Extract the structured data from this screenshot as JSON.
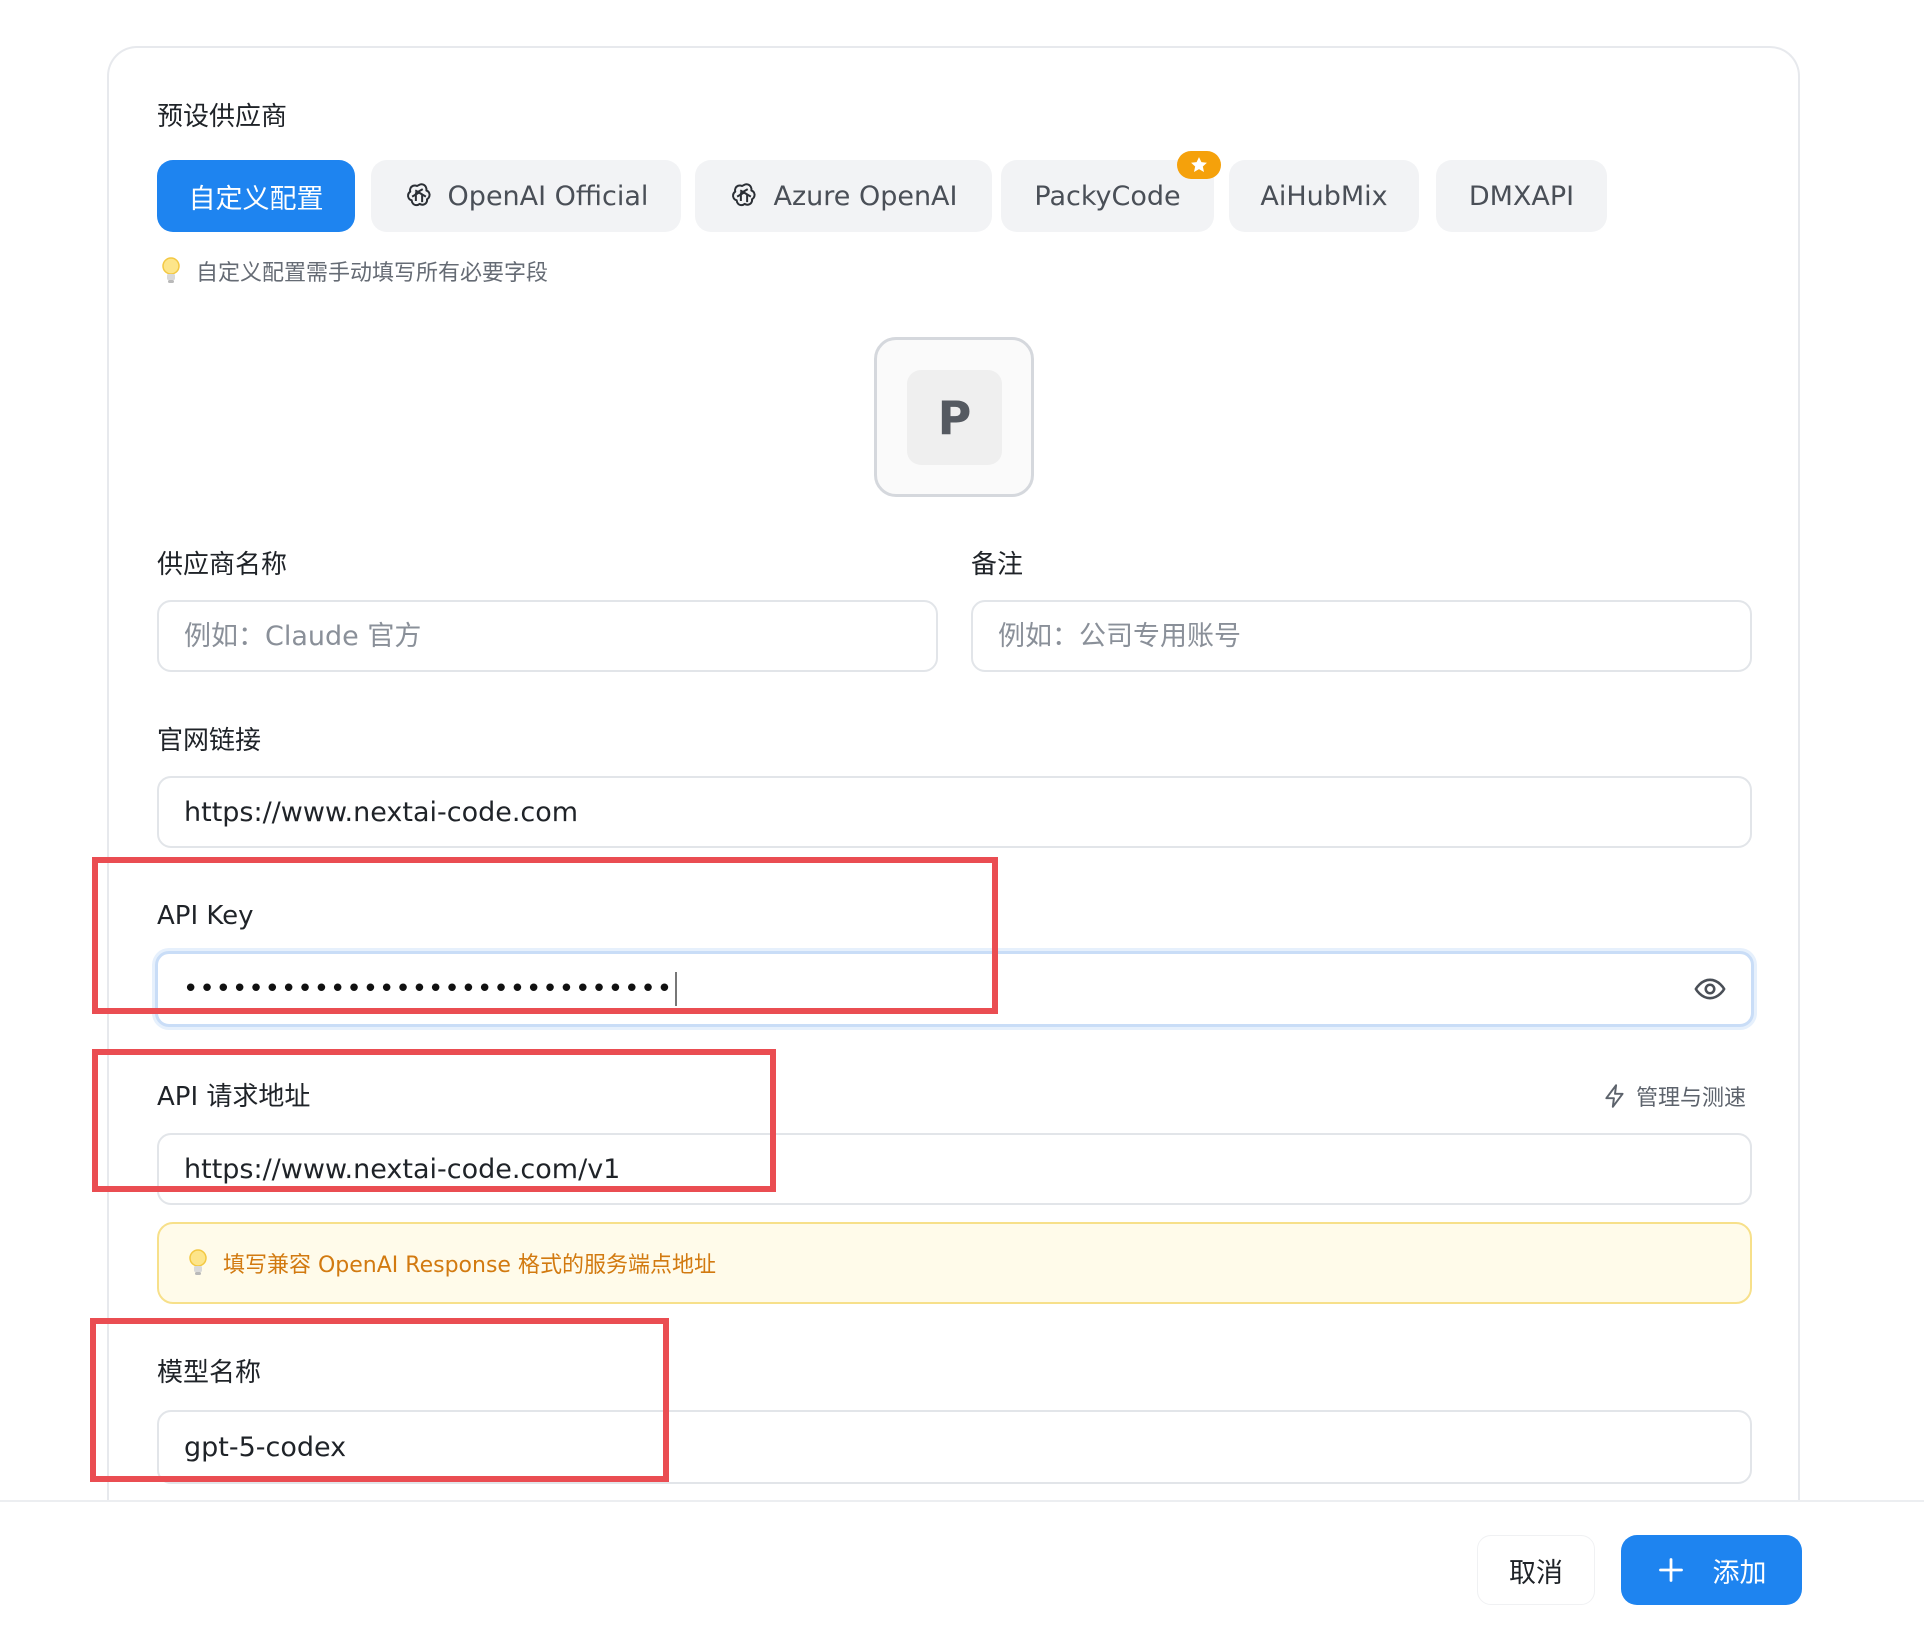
{
  "presets": {
    "heading": "预设供应商",
    "items": [
      {
        "label": "自定义配置",
        "active": true,
        "icon": ""
      },
      {
        "label": "OpenAI Official",
        "active": false,
        "icon": "openai-icon"
      },
      {
        "label": "Azure OpenAI",
        "active": false,
        "icon": "openai-icon"
      },
      {
        "label": "PackyCode",
        "active": false,
        "icon": "",
        "badge": "star-icon"
      },
      {
        "label": "AiHubMix",
        "active": false,
        "icon": ""
      },
      {
        "label": "DMXAPI",
        "active": false,
        "icon": ""
      }
    ],
    "hint": "自定义配置需手动填写所有必要字段"
  },
  "logo": {
    "letter": "P"
  },
  "form": {
    "provider_name": {
      "label": "供应商名称",
      "placeholder": "例如：Claude 官方",
      "value": ""
    },
    "note": {
      "label": "备注",
      "placeholder": "例如：公司专用账号",
      "value": ""
    },
    "website": {
      "label": "官网链接",
      "value": "https://www.nextai-code.com"
    },
    "api_key": {
      "label": "API Key",
      "masked_value": "••••••••••••••••••••••••••••••"
    },
    "api_endpoint": {
      "label": "API 请求地址",
      "value": "https://www.nextai-code.com/v1",
      "manage_label": "管理与测速"
    },
    "endpoint_hint": "填写兼容 OpenAI Response 格式的服务端点地址",
    "model_name": {
      "label": "模型名称",
      "value": "gpt-5-codex"
    }
  },
  "footer": {
    "cancel_label": "取消",
    "add_label": "添加"
  },
  "colors": {
    "accent": "#1e84f0",
    "annotation": "#ea4d52",
    "warning_text": "#d27a10",
    "warning_bg": "#fffbea",
    "badge": "#f5a10b"
  }
}
